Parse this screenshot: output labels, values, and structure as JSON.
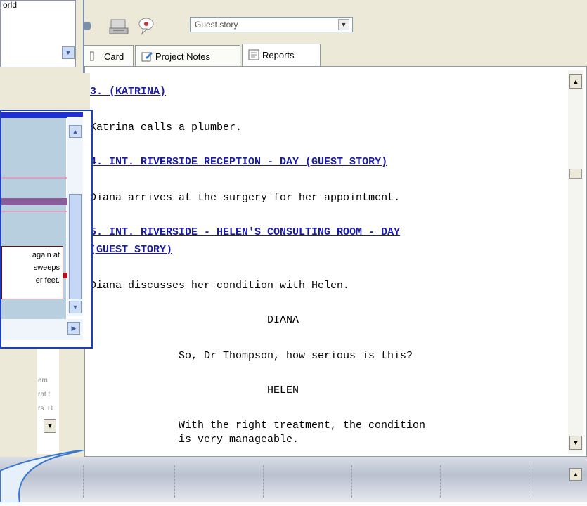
{
  "toolbar": {
    "story_select_value": "Guest story"
  },
  "tabs": [
    {
      "label": "Card"
    },
    {
      "label": "Project Notes"
    },
    {
      "label": "Reports"
    }
  ],
  "script": {
    "lines": [
      {
        "text": "3. (KATRINA)",
        "kind": "heading"
      },
      {
        "text": "Katrina calls a plumber.",
        "kind": "action"
      },
      {
        "text": "4. INT. RIVERSIDE RECEPTION - DAY (GUEST STORY)",
        "kind": "heading"
      },
      {
        "text": "Diana arrives at the surgery for her appointment.",
        "kind": "action"
      },
      {
        "text": "5. INT. RIVERSIDE - HELEN'S CONSULTING ROOM - DAY",
        "kind": "heading"
      },
      {
        "text": "(GUEST STORY)",
        "kind": "heading"
      },
      {
        "text": "Diana discusses her condition with Helen.",
        "kind": "action"
      },
      {
        "text": "DIANA",
        "kind": "character"
      },
      {
        "text": "So, Dr Thompson, how serious is this?",
        "kind": "dialogue"
      },
      {
        "text": "HELEN",
        "kind": "character"
      },
      {
        "text": "With the right treatment, the condition",
        "kind": "dialogue"
      },
      {
        "text": "is very manageable.",
        "kind": "dialogue"
      }
    ]
  },
  "left_top": {
    "text": "orld"
  },
  "card_note": {
    "lines": [
      "again at",
      "sweeps",
      "er feet."
    ]
  },
  "lower_left": {
    "lines": [
      "am",
      "rat t",
      "rs. H"
    ]
  },
  "colors": {
    "heading": "#1a1aa6",
    "card_border": "#1e3fb8",
    "card_body": "#b8cfe0"
  }
}
